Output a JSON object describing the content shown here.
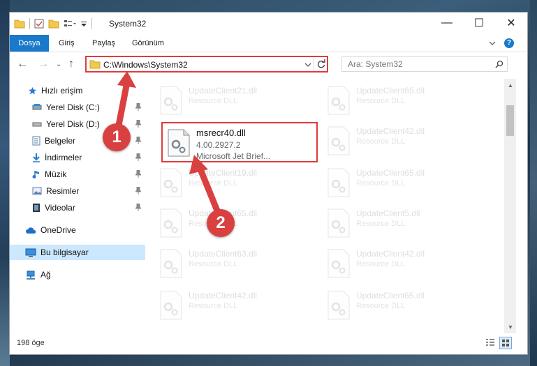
{
  "window": {
    "title": "System32"
  },
  "ribbon": {
    "tabs": [
      "Dosya",
      "Giriş",
      "Paylaş",
      "Görünüm"
    ]
  },
  "address": {
    "path": "C:\\Windows\\System32"
  },
  "search": {
    "placeholder": "Ara: System32"
  },
  "sidebar": {
    "items": [
      {
        "label": "Hızlı erişim",
        "icon": "star-icon"
      },
      {
        "label": "Yerel Disk (C:)",
        "icon": "disk-icon"
      },
      {
        "label": "Yerel Disk (D:)",
        "icon": "disk-icon"
      },
      {
        "label": "Belgeler",
        "icon": "documents-icon"
      },
      {
        "label": "İndirmeler",
        "icon": "download-icon"
      },
      {
        "label": "Müzik",
        "icon": "music-icon"
      },
      {
        "label": "Resimler",
        "icon": "pictures-icon"
      },
      {
        "label": "Videolar",
        "icon": "videos-icon"
      },
      {
        "label": "OneDrive",
        "icon": "cloud-icon"
      },
      {
        "label": "Bu bilgisayar",
        "icon": "computer-icon"
      },
      {
        "label": "Ağ",
        "icon": "network-icon"
      }
    ]
  },
  "files": {
    "highlighted": {
      "name": "msrecr40.dll",
      "version": "4.00.2927.2",
      "description": "Microsoft Jet Brief..."
    },
    "background": [
      {
        "name": "UpdateClient21.dll",
        "type": "Resource DLL"
      },
      {
        "name": "UpdateClient65.dll",
        "type": "Resource DLL"
      },
      {
        "name": "UpdateClient42.dll",
        "type": "Resource DLL"
      },
      {
        "name": "UpdateClient19.dll",
        "type": "Resource DLL"
      },
      {
        "name": "UpdateClient65.dll",
        "type": "Resource DLL"
      },
      {
        "name": "UpdateClient65.dll",
        "type": "Resource DLL"
      },
      {
        "name": "UpdateClient5.dll",
        "type": "Resource DLL"
      },
      {
        "name": "UpdateClient63.dll",
        "type": "Resource DLL"
      },
      {
        "name": "UpdateClient42.dll",
        "type": "Resource DLL"
      },
      {
        "name": "UpdateClient42.dll",
        "type": "Resource DLL"
      },
      {
        "name": "UpdateClient65.dll",
        "type": "Resource DLL"
      }
    ]
  },
  "status": {
    "count": "198 öge"
  },
  "annotations": {
    "step1": "1",
    "step2": "2"
  },
  "colors": {
    "accent": "#1979ca",
    "highlight": "#e03b3b",
    "selection": "#cce8ff"
  }
}
